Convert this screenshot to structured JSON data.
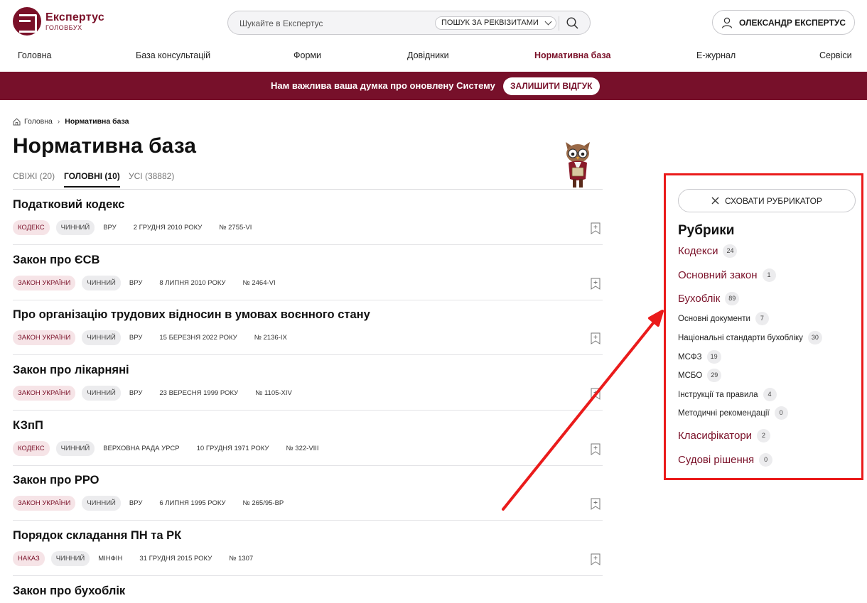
{
  "header": {
    "logo_title": "Експертус",
    "logo_sub": "ГОЛОВБУХ",
    "search_placeholder": "Шукайте в Експертус",
    "search_requisites": "ПОШУК ЗА РЕКВІЗИТАМИ",
    "user_name": "ОЛЕКСАНДР ЕКСПЕРТУС"
  },
  "nav": [
    {
      "label": "Головна"
    },
    {
      "label": "База консультацій"
    },
    {
      "label": "Форми"
    },
    {
      "label": "Довідники"
    },
    {
      "label": "Нормативна база",
      "active": true
    },
    {
      "label": "Е-журнал"
    },
    {
      "label": "Сервіси"
    }
  ],
  "banner": {
    "text": "Нам важлива ваша думка про оновлену Систему",
    "button": "ЗАЛИШИТИ ВІДГУК"
  },
  "breadcrumb": {
    "home": "Головна",
    "current": "Нормативна база"
  },
  "page_title": "Нормативна база",
  "tabs": [
    {
      "label": "СВІЖІ (20)"
    },
    {
      "label": "ГОЛОВНІ (10)",
      "active": true
    },
    {
      "label": "УСІ (38882)"
    }
  ],
  "documents": [
    {
      "title": "Податковий кодекс",
      "type": "КОДЕКС",
      "status": "ЧИННИЙ",
      "issuer": "ВРУ",
      "date": "2 ГРУДНЯ 2010 РОКУ",
      "number": "№ 2755-VI"
    },
    {
      "title": "Закон про ЄСВ",
      "type": "ЗАКОН УКРАЇНИ",
      "status": "ЧИННИЙ",
      "issuer": "ВРУ",
      "date": "8 ЛИПНЯ 2010 РОКУ",
      "number": "№ 2464-VI"
    },
    {
      "title": "Про організацію трудових відносин в умовах воєнного стану",
      "type": "ЗАКОН УКРАЇНИ",
      "status": "ЧИННИЙ",
      "issuer": "ВРУ",
      "date": "15 БЕРЕЗНЯ 2022 РОКУ",
      "number": "№ 2136-IX"
    },
    {
      "title": "Закон про лікарняні",
      "type": "ЗАКОН УКРАЇНИ",
      "status": "ЧИННИЙ",
      "issuer": "ВРУ",
      "date": "23 ВЕРЕСНЯ 1999 РОКУ",
      "number": "№ 1105-XIV"
    },
    {
      "title": "КЗпП",
      "type": "КОДЕКС",
      "status": "ЧИННИЙ",
      "issuer": "ВЕРХОВНА РАДА УРСР",
      "date": "10 ГРУДНЯ 1971 РОКУ",
      "number": "№ 322-VIII"
    },
    {
      "title": "Закон про РРО",
      "type": "ЗАКОН УКРАЇНИ",
      "status": "ЧИННИЙ",
      "issuer": "ВРУ",
      "date": "6 ЛИПНЯ 1995 РОКУ",
      "number": "№ 265/95-ВР"
    },
    {
      "title": "Порядок складання ПН та РК",
      "type": "НАКАЗ",
      "status": "ЧИННИЙ",
      "issuer": "МІНФІН",
      "date": "31 ГРУДНЯ 2015 РОКУ",
      "number": "№ 1307"
    },
    {
      "title": "Закон про бухоблік"
    }
  ],
  "rubricator": {
    "hide_button": "СХОВАТИ РУБРИКАТОР",
    "heading": "Рубрики",
    "items": [
      {
        "label": "Кодекси",
        "count": "24",
        "level": "main"
      },
      {
        "label": "Основний закон",
        "count": "1",
        "level": "main"
      },
      {
        "label": "Бухоблік",
        "count": "89",
        "level": "main"
      },
      {
        "label": "Основні документи",
        "count": "7",
        "level": "sub"
      },
      {
        "label": "Національні стандарти бухобліку",
        "count": "30",
        "level": "sub"
      },
      {
        "label": "МСФЗ",
        "count": "19",
        "level": "sub"
      },
      {
        "label": "МСБО",
        "count": "29",
        "level": "sub"
      },
      {
        "label": "Інструкції та правила",
        "count": "4",
        "level": "sub"
      },
      {
        "label": "Методичні рекомендації",
        "count": "0",
        "level": "sub"
      },
      {
        "label": "Класифікатори",
        "count": "2",
        "level": "main"
      },
      {
        "label": "Судові рішення",
        "count": "0",
        "level": "main"
      }
    ]
  },
  "colors": {
    "brand": "#7a1028",
    "banner": "#77102a",
    "annotation": "#ea1b1b"
  }
}
